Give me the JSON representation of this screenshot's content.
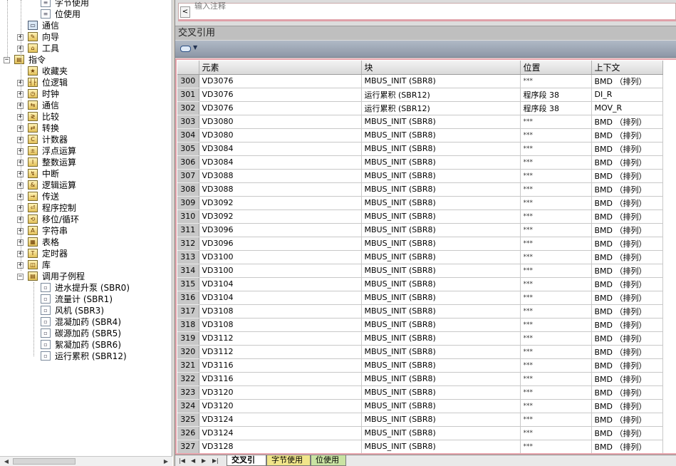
{
  "tree": {
    "items": [
      {
        "label": "字节使用",
        "icon": "doc-table-icon",
        "depth": 4
      },
      {
        "label": "位使用",
        "icon": "doc-table-icon",
        "depth": 4
      },
      {
        "label": "通信",
        "icon": "computer-icon",
        "depth": 2
      },
      {
        "label": "向导",
        "icon": "wizard-icon",
        "depth": 2
      },
      {
        "label": "工具",
        "icon": "tools-icon",
        "depth": 2
      },
      {
        "label": "指令",
        "icon": "folder-icon",
        "depth": 0
      },
      {
        "label": "收藏夹",
        "icon": "favorites-icon",
        "depth": 2
      },
      {
        "label": "位逻辑",
        "icon": "bit-logic-icon",
        "depth": 2
      },
      {
        "label": "时钟",
        "icon": "clock-icon",
        "depth": 2
      },
      {
        "label": "通信",
        "icon": "communication-icon",
        "depth": 2
      },
      {
        "label": "比较",
        "icon": "compare-icon",
        "depth": 2
      },
      {
        "label": "转换",
        "icon": "convert-icon",
        "depth": 2
      },
      {
        "label": "计数器",
        "icon": "counter-icon",
        "depth": 2
      },
      {
        "label": "浮点运算",
        "icon": "float-math-icon",
        "depth": 2
      },
      {
        "label": "整数运算",
        "icon": "integer-math-icon",
        "depth": 2
      },
      {
        "label": "中断",
        "icon": "interrupt-icon",
        "depth": 2
      },
      {
        "label": "逻辑运算",
        "icon": "logic-op-icon",
        "depth": 2
      },
      {
        "label": "传送",
        "icon": "move-icon",
        "depth": 2
      },
      {
        "label": "程序控制",
        "icon": "program-control-icon",
        "depth": 2
      },
      {
        "label": "移位/循环",
        "icon": "shift-rotate-icon",
        "depth": 2
      },
      {
        "label": "字符串",
        "icon": "string-icon",
        "depth": 2
      },
      {
        "label": "表格",
        "icon": "table-icon",
        "depth": 2
      },
      {
        "label": "定时器",
        "icon": "timer-icon",
        "depth": 2
      },
      {
        "label": "库",
        "icon": "library-icon",
        "depth": 2
      },
      {
        "label": "调用子例程",
        "icon": "subroutine-folder-icon",
        "depth": 2
      },
      {
        "label": "进水提升泵 (SBR0)",
        "icon": "subroutine-icon",
        "depth": 4
      },
      {
        "label": "流量计 (SBR1)",
        "icon": "subroutine-icon",
        "depth": 4
      },
      {
        "label": "风机 (SBR3)",
        "icon": "subroutine-icon",
        "depth": 4
      },
      {
        "label": "混凝加药 (SBR4)",
        "icon": "subroutine-icon",
        "depth": 4
      },
      {
        "label": "碳源加药 (SBR5)",
        "icon": "subroutine-icon",
        "depth": 4
      },
      {
        "label": "絮凝加药 (SBR6)",
        "icon": "subroutine-icon",
        "depth": 4
      },
      {
        "label": "运行累积 (SBR12)",
        "icon": "subroutine-icon",
        "depth": 4
      }
    ]
  },
  "top_input": {
    "cut_text": "输入注释"
  },
  "xref": {
    "title": "交叉引用",
    "columns": [
      "元素",
      "块",
      "位置",
      "上下文"
    ],
    "rows": [
      {
        "n": "300",
        "element": "VD3076",
        "block": "MBUS_INIT (SBR8)",
        "location": "***",
        "context": "BMD （排列）"
      },
      {
        "n": "301",
        "element": "VD3076",
        "block": "运行累积 (SBR12)",
        "location": "程序段 38",
        "context": "DI_R"
      },
      {
        "n": "302",
        "element": "VD3076",
        "block": "运行累积 (SBR12)",
        "location": "程序段 38",
        "context": "MOV_R"
      },
      {
        "n": "303",
        "element": "VD3080",
        "block": "MBUS_INIT (SBR8)",
        "location": "***",
        "context": "BMD （排列）"
      },
      {
        "n": "304",
        "element": "VD3080",
        "block": "MBUS_INIT (SBR8)",
        "location": "***",
        "context": "BMD （排列）"
      },
      {
        "n": "305",
        "element": "VD3084",
        "block": "MBUS_INIT (SBR8)",
        "location": "***",
        "context": "BMD （排列）"
      },
      {
        "n": "306",
        "element": "VD3084",
        "block": "MBUS_INIT (SBR8)",
        "location": "***",
        "context": "BMD （排列）"
      },
      {
        "n": "307",
        "element": "VD3088",
        "block": "MBUS_INIT (SBR8)",
        "location": "***",
        "context": "BMD （排列）"
      },
      {
        "n": "308",
        "element": "VD3088",
        "block": "MBUS_INIT (SBR8)",
        "location": "***",
        "context": "BMD （排列）"
      },
      {
        "n": "309",
        "element": "VD3092",
        "block": "MBUS_INIT (SBR8)",
        "location": "***",
        "context": "BMD （排列）"
      },
      {
        "n": "310",
        "element": "VD3092",
        "block": "MBUS_INIT (SBR8)",
        "location": "***",
        "context": "BMD （排列）"
      },
      {
        "n": "311",
        "element": "VD3096",
        "block": "MBUS_INIT (SBR8)",
        "location": "***",
        "context": "BMD （排列）"
      },
      {
        "n": "312",
        "element": "VD3096",
        "block": "MBUS_INIT (SBR8)",
        "location": "***",
        "context": "BMD （排列）"
      },
      {
        "n": "313",
        "element": "VD3100",
        "block": "MBUS_INIT (SBR8)",
        "location": "***",
        "context": "BMD （排列）"
      },
      {
        "n": "314",
        "element": "VD3100",
        "block": "MBUS_INIT (SBR8)",
        "location": "***",
        "context": "BMD （排列）"
      },
      {
        "n": "315",
        "element": "VD3104",
        "block": "MBUS_INIT (SBR8)",
        "location": "***",
        "context": "BMD （排列）"
      },
      {
        "n": "316",
        "element": "VD3104",
        "block": "MBUS_INIT (SBR8)",
        "location": "***",
        "context": "BMD （排列）"
      },
      {
        "n": "317",
        "element": "VD3108",
        "block": "MBUS_INIT (SBR8)",
        "location": "***",
        "context": "BMD （排列）"
      },
      {
        "n": "318",
        "element": "VD3108",
        "block": "MBUS_INIT (SBR8)",
        "location": "***",
        "context": "BMD （排列）"
      },
      {
        "n": "319",
        "element": "VD3112",
        "block": "MBUS_INIT (SBR8)",
        "location": "***",
        "context": "BMD （排列）"
      },
      {
        "n": "320",
        "element": "VD3112",
        "block": "MBUS_INIT (SBR8)",
        "location": "***",
        "context": "BMD （排列）"
      },
      {
        "n": "321",
        "element": "VD3116",
        "block": "MBUS_INIT (SBR8)",
        "location": "***",
        "context": "BMD （排列）"
      },
      {
        "n": "322",
        "element": "VD3116",
        "block": "MBUS_INIT (SBR8)",
        "location": "***",
        "context": "BMD （排列）"
      },
      {
        "n": "323",
        "element": "VD3120",
        "block": "MBUS_INIT (SBR8)",
        "location": "***",
        "context": "BMD （排列）"
      },
      {
        "n": "324",
        "element": "VD3120",
        "block": "MBUS_INIT (SBR8)",
        "location": "***",
        "context": "BMD （排列）"
      },
      {
        "n": "325",
        "element": "VD3124",
        "block": "MBUS_INIT (SBR8)",
        "location": "***",
        "context": "BMD （排列）"
      },
      {
        "n": "326",
        "element": "VD3124",
        "block": "MBUS_INIT (SBR8)",
        "location": "***",
        "context": "BMD （排列）"
      },
      {
        "n": "327",
        "element": "VD3128",
        "block": "MBUS_INIT (SBR8)",
        "location": "***",
        "context": "BMD （排列）"
      }
    ]
  },
  "bottom_tabs": {
    "xref": "交叉引用",
    "byte_usage": "字节使用",
    "bit_usage": "位使用"
  }
}
